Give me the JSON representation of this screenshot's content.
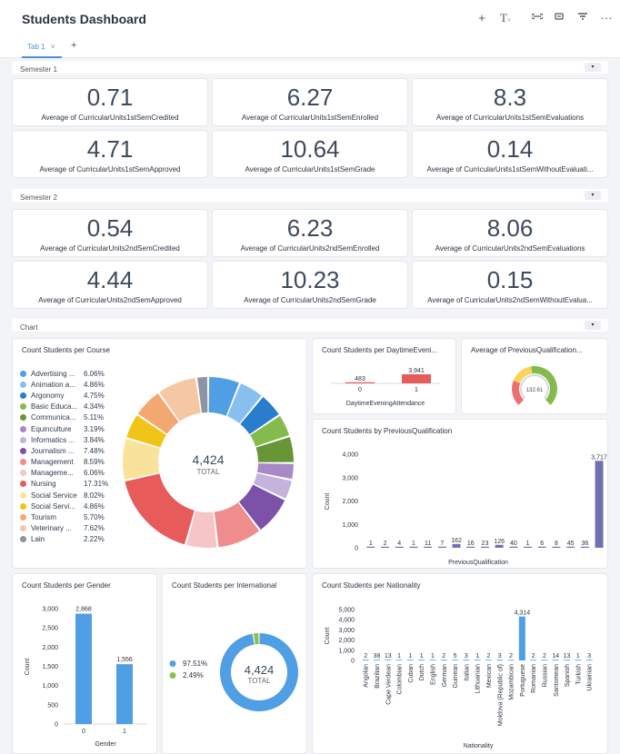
{
  "app": {
    "title": "Students Dashboard",
    "tab": "Tab 1"
  },
  "sections": {
    "sem1": "Semester 1",
    "sem2": "Semester 2",
    "chart": "Chart"
  },
  "kpis": [
    {
      "value": "0.71",
      "label": "Average of CurricularUnits1stSemCredited"
    },
    {
      "value": "6.27",
      "label": "Average of CurricularUnits1stSemEnrolled"
    },
    {
      "value": "8.3",
      "label": "Average of CurricularUnits1stSemEvaluations"
    },
    {
      "value": "4.71",
      "label": "Average of CurricularUnits1stSemApproved"
    },
    {
      "value": "10.64",
      "label": "Average of CurricularUnits1stSemGrade"
    },
    {
      "value": "0.14",
      "label": "Average of CurricularUnits1stSemWithoutEvaluati..."
    },
    {
      "value": "0.54",
      "label": "Average of CurricularUnits2ndSemCredited"
    },
    {
      "value": "6.23",
      "label": "Average of CurricularUnits2ndSemEnrolled"
    },
    {
      "value": "8.06",
      "label": "Average of CurricularUnits2ndSemEvaluations"
    },
    {
      "value": "4.44",
      "label": "Average of CurricularUnits2ndSemApproved"
    },
    {
      "value": "10.23",
      "label": "Average of CurricularUnits2ndSemGrade"
    },
    {
      "value": "0.15",
      "label": "Average of CurricularUnits2ndSemWithoutEvalua..."
    }
  ],
  "chart_data": [
    {
      "type": "pie",
      "title": "Count Students per Course",
      "center_value": "4,424",
      "center_label": "TOTAL",
      "categories": [
        "Advertising ...",
        "Animation a...",
        "Argonomy",
        "Basic Educa...",
        "Communica...",
        "Equinculture",
        "Informatics ...",
        "Journalism ...",
        "Management",
        "Manageme...",
        "Nursing",
        "Social Service",
        "Social Servi...",
        "Tourism",
        "Veterinary ...",
        "Lain"
      ],
      "percent_labels": [
        "6.06%",
        "4.86%",
        "4.75%",
        "4.34%",
        "5.11%",
        "3.19%",
        "3.84%",
        "7.48%",
        "8.59%",
        "6.06%",
        "17.31%",
        "8.02%",
        "4.86%",
        "5.70%",
        "7.62%",
        "2.22%"
      ],
      "values": [
        6.06,
        4.86,
        4.75,
        4.34,
        5.11,
        3.19,
        3.84,
        7.48,
        8.59,
        6.06,
        17.31,
        8.02,
        4.86,
        5.7,
        7.62,
        2.22
      ],
      "colors": [
        "#509ee3",
        "#88bff0",
        "#2a7ccc",
        "#84bb4c",
        "#689636",
        "#a989c5",
        "#c5b3dd",
        "#7b52a8",
        "#ef8c8c",
        "#f6c6c6",
        "#e75b5b",
        "#f9e29c",
        "#f0c419",
        "#f2a86f",
        "#f5c7a3",
        "#8c95a1"
      ]
    },
    {
      "type": "bar",
      "title": "Count Students per DaytimeEveni...",
      "xlabel": "DaytimeEveningAttendance",
      "categories": [
        "0",
        "1"
      ],
      "values": [
        483,
        3941
      ],
      "value_labels": [
        "483",
        "3,941"
      ],
      "color": "#e75b5b"
    },
    {
      "type": "gauge",
      "title": "Average of PreviousQualification...",
      "value": 132.61,
      "value_label": "132.61"
    },
    {
      "type": "bar",
      "title": "Count Students by PreviousQualification",
      "xlabel": "PreviousQualification",
      "ylabel": "Count",
      "ylim": [
        0,
        4000
      ],
      "yticks": [
        "0",
        "1,000",
        "2,000",
        "3,000",
        "4,000"
      ],
      "values": [
        1,
        2,
        4,
        1,
        11,
        7,
        162,
        16,
        23,
        126,
        40,
        1,
        6,
        8,
        45,
        36,
        3717,
        219
      ],
      "value_labels": [
        "1",
        "2",
        "4",
        "1",
        "11",
        "7",
        "162",
        "16",
        "23",
        "126",
        "40",
        "1",
        "6",
        "8",
        "45",
        "36",
        "3,717",
        "219"
      ],
      "color": "#7172ad"
    },
    {
      "type": "bar",
      "title": "Count Students per Gender",
      "xlabel": "Gender",
      "ylabel": "Count",
      "ylim": [
        0,
        3000
      ],
      "yticks": [
        "0",
        "500",
        "1,000",
        "1,500",
        "2,000",
        "2,500",
        "3,000"
      ],
      "categories": [
        "0",
        "1"
      ],
      "values": [
        2868,
        1556
      ],
      "value_labels": [
        "2,868",
        "1,556"
      ],
      "color": "#509ee3"
    },
    {
      "type": "pie",
      "title": "Count Students per International",
      "center_value": "4,424",
      "center_label": "TOTAL",
      "percent_labels": [
        "97.51%",
        "2.49%"
      ],
      "values": [
        97.51,
        2.49
      ],
      "colors": [
        "#509ee3",
        "#88bf4d"
      ]
    },
    {
      "type": "bar",
      "title": "Count Students per Nationality",
      "xlabel": "Nationality",
      "ylabel": "Count",
      "ylim": [
        0,
        5000
      ],
      "yticks": [
        "0",
        "1,000",
        "2,000",
        "3,000",
        "4,000",
        "5,000"
      ],
      "categories": [
        "Angolan",
        "Brazilian",
        "Cape Verdean",
        "Colombian",
        "Cuban",
        "Dutch",
        "English",
        "German",
        "Guinean",
        "Italian",
        "Lithuanian",
        "Mexican",
        "Moldova (Republic of)",
        "Mozambican",
        "Portuguese",
        "Romanian",
        "Russian",
        "Santomean",
        "Spanish",
        "Turkish",
        "Ukrainian"
      ],
      "values": [
        2,
        38,
        13,
        1,
        1,
        1,
        1,
        2,
        5,
        3,
        1,
        2,
        3,
        2,
        4314,
        2,
        2,
        14,
        13,
        1,
        3
      ],
      "value_labels": [
        "2",
        "38",
        "13",
        "1",
        "1",
        "1",
        "1",
        "2",
        "5",
        "3",
        "1",
        "2",
        "3",
        "2",
        "4,314",
        "2",
        "2",
        "14",
        "13",
        "1",
        "3"
      ],
      "color": "#509ee3"
    }
  ]
}
